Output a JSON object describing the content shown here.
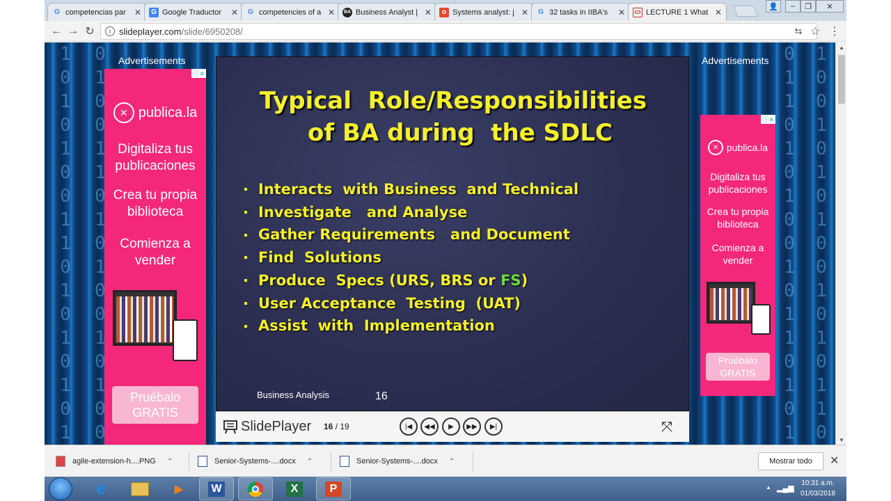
{
  "browser": {
    "tabs": [
      {
        "title": "competencias par",
        "favicon": "google-icon",
        "color": "#4285f4"
      },
      {
        "title": "Google Traductor",
        "favicon": "google-translate-icon",
        "color": "#4285f4"
      },
      {
        "title": "competencies of a",
        "favicon": "google-icon",
        "color": "#4285f4"
      },
      {
        "title": "Business Analyst |",
        "favicon": "ba-icon",
        "color": "#222222"
      },
      {
        "title": "Systems analyst: j",
        "favicon": "red-o-icon",
        "color": "#e34a2f"
      },
      {
        "title": "32 tasks in IIBA's",
        "favicon": "google-icon",
        "color": "#4285f4"
      },
      {
        "title": "LECTURE 1 What",
        "favicon": "slideplayer-icon",
        "color": "#c0392b"
      }
    ],
    "url_host": "slideplayer.com",
    "url_path": "/slide/6950208/"
  },
  "ads": {
    "label": "Advertisements",
    "brand": "publica.la",
    "line1a": "Digitaliza tus",
    "line1b": "publicaciones",
    "line2a": "Crea tu propia",
    "line2b": "biblioteca",
    "line3a": "Comienza a",
    "line3b": "vender",
    "cta_a": "Pruébalo",
    "cta_b": "GRATIS",
    "accent": "#f4287a"
  },
  "slide": {
    "title_line1": "Typical  Role/Responsibilities",
    "title_line2": "of BA during  the SDLC",
    "bullets": [
      "Interacts  with Business  and Technical",
      "Investigate   and Analyse",
      "Gather Requirements   and Document",
      "Find  Solutions",
      "Produce  Specs (URS, BRS or ",
      "User Acceptance  Testing  (UAT)",
      "Assist  with  Implementation"
    ],
    "bullet5_green": "FS",
    "bullet5_end": ")",
    "footer": "Business Analysis",
    "number": "16",
    "title_color": "#f5f02c"
  },
  "player": {
    "name": "SlidePlayer",
    "current": "16",
    "total": " / 19"
  },
  "downloads": {
    "items": [
      "agile-extension-h....PNG",
      "Senior-Systems-....docx",
      "Senior-Systems-....docx"
    ],
    "show_all": "Mostrar todo"
  },
  "taskbar": {
    "apps": [
      "ie-icon",
      "explorer-icon",
      "media-player-icon",
      "word-icon",
      "chrome-icon",
      "excel-icon",
      "powerpoint-icon"
    ],
    "time": "10:31 a.m.",
    "date": "01/03/2018"
  }
}
